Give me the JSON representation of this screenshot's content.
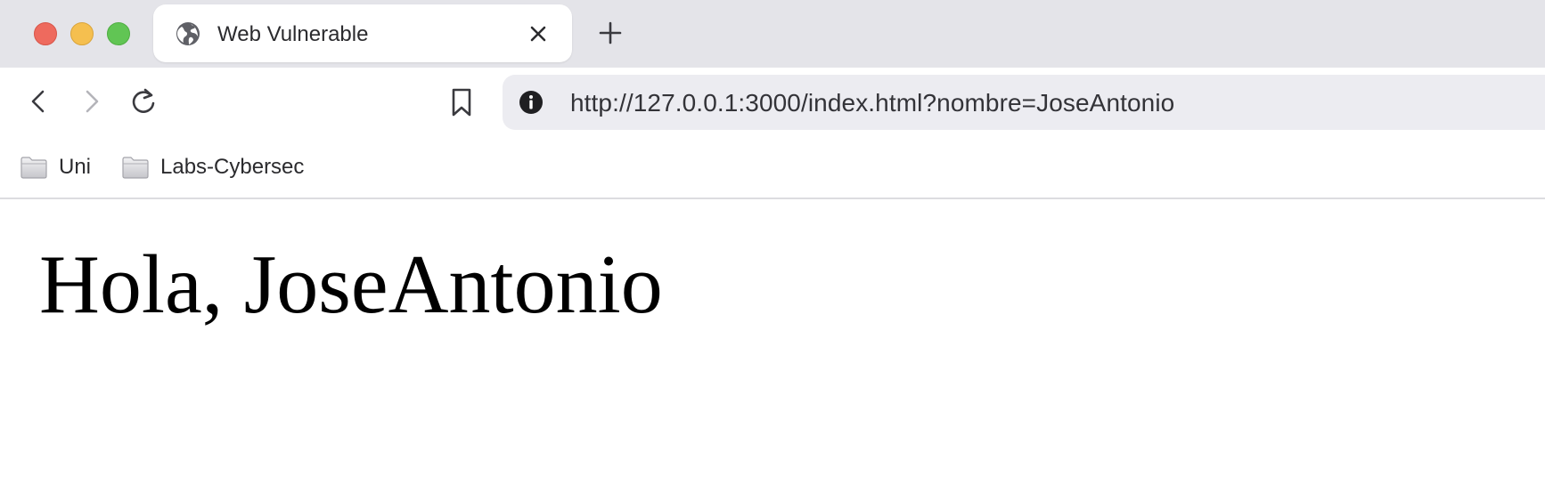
{
  "colors": {
    "tabstrip_bg": "#e4e4e9",
    "omnibox_bg": "#ececf1",
    "traffic_close": "#ee6a5e",
    "traffic_minimize": "#f5bf4f",
    "traffic_maximize": "#61c554"
  },
  "window_controls": {
    "close_icon": "traffic-light-close",
    "minimize_icon": "traffic-light-minimize",
    "maximize_icon": "traffic-light-maximize"
  },
  "tabs": [
    {
      "title": "Web Vulnerable",
      "favicon": "globe-icon",
      "active": true
    }
  ],
  "toolbar": {
    "back_icon": "chevron-left-icon",
    "forward_icon": "chevron-right-icon",
    "forward_enabled": false,
    "reload_icon": "reload-icon",
    "bookmark_icon": "bookmark-icon",
    "site_info_icon": "info-icon",
    "url": "http://127.0.0.1:3000/index.html?nombre=JoseAntonio"
  },
  "bookmarks": [
    {
      "label": "Uni",
      "icon": "folder-icon"
    },
    {
      "label": "Labs-Cybersec",
      "icon": "folder-icon"
    }
  ],
  "page": {
    "heading": "Hola, JoseAntonio"
  }
}
